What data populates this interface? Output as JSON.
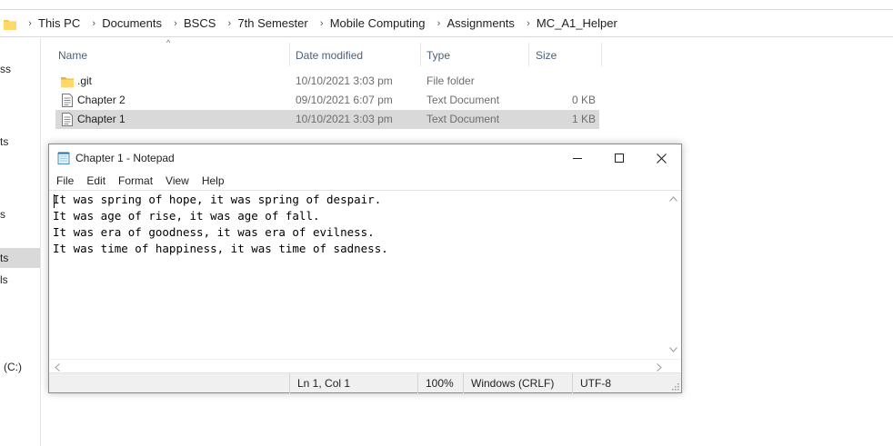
{
  "explorer": {
    "breadcrumb": [
      "This PC",
      "Documents",
      "BSCS",
      "7th Semester",
      "Mobile Computing",
      "Assignments",
      "MC_A1_Helper"
    ],
    "nav_items": [
      "ss",
      "ts",
      "s",
      "ts",
      "ls",
      "(C:)"
    ],
    "columns": {
      "name": "Name",
      "date": "Date modified",
      "type": "Type",
      "size": "Size"
    },
    "files": [
      {
        "name": ".git",
        "date": "10/10/2021 3:03 pm",
        "type": "File folder",
        "size": "",
        "icon": "folder-icon"
      },
      {
        "name": "Chapter 2",
        "date": "09/10/2021 6:07 pm",
        "type": "Text Document",
        "size": "0 KB",
        "icon": "text-file-icon"
      },
      {
        "name": "Chapter 1",
        "date": "10/10/2021 3:03 pm",
        "type": "Text Document",
        "size": "1 KB",
        "icon": "text-file-icon"
      }
    ]
  },
  "notepad": {
    "title": "Chapter 1 - Notepad",
    "menu": [
      "File",
      "Edit",
      "Format",
      "View",
      "Help"
    ],
    "lines": [
      "It was spring of hope, it was spring of despair.",
      "It was age of rise, it was age of fall.",
      "It was era of goodness, it was era of evilness.",
      "It was time of happiness, it was time of sadness."
    ],
    "status": {
      "position": "Ln 1, Col 1",
      "zoom": "100%",
      "line_ending": "Windows (CRLF)",
      "encoding": "UTF-8"
    }
  },
  "colors": {
    "folder": "#f8c94a",
    "selection": "#d9d9d9",
    "header_text": "#4c607a"
  }
}
